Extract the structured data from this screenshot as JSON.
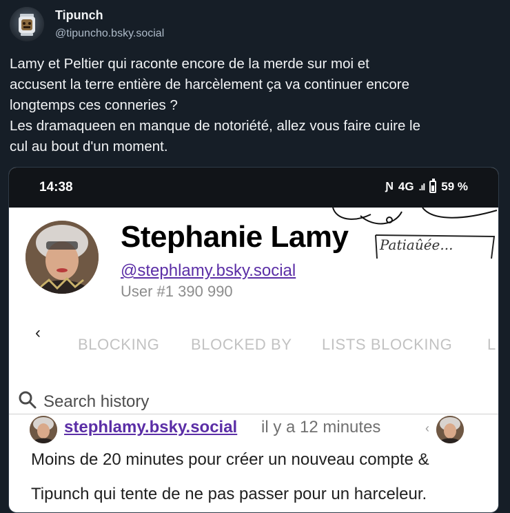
{
  "post": {
    "author": {
      "display_name": "Tipunch",
      "handle": "@tipuncho.bsky.social",
      "avatar_icon": "tiki-lantern-avatar"
    },
    "text": "Lamy et Peltier qui raconte encore de la merde sur moi et\naccusent la terre entière de harcèlement ça va continuer encore\nlongtemps ces conneries ?\nLes dramaqueen en manque de notoriété, allez vous faire cuire le\ncul au bout d'un moment."
  },
  "embedded_screenshot": {
    "status_bar": {
      "time": "14:38",
      "network": "4G",
      "battery": "59 %",
      "icons": [
        "nfc-icon",
        "signal-icon",
        "battery-icon"
      ]
    },
    "profile": {
      "name": "Stephanie Lamy",
      "handwritten_note": "Patiaûée...",
      "handle": "@stephlamy.bsky.social",
      "user_number": "User #1 390 990"
    },
    "tabs": [
      "BLOCKING",
      "BLOCKED BY",
      "LISTS BLOCKING",
      "L"
    ],
    "search": {
      "placeholder": "Search history"
    },
    "history_item": {
      "handle": "stephlamy.bsky.social",
      "time": "il y a 12 minutes",
      "line1": "Moins de 20 minutes pour créer un nouveau compte &",
      "line2": "Tipunch qui tente de ne pas passer pour un harceleur."
    }
  },
  "colors": {
    "background": "#161e27",
    "text": "#f1f3f5",
    "handle": "#aebbc9",
    "link_purple": "#5b2ea6",
    "tab_inactive": "#c2c2c2"
  }
}
